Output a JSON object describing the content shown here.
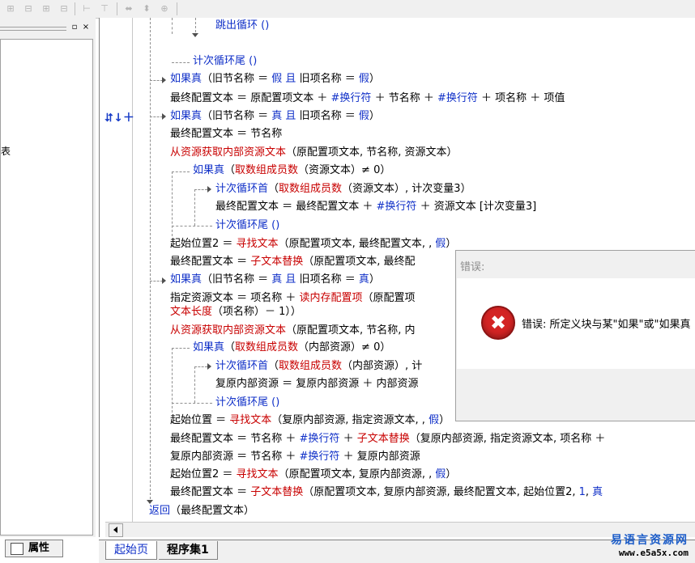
{
  "toolbar": {
    "icons": [
      "align-left-icon",
      "align-center-icon",
      "align-right-icon",
      "align-top-icon",
      "distribute-horizontal-icon",
      "align-bottom-icon",
      "same-width-icon",
      "same-height-icon",
      "same-size-icon"
    ]
  },
  "left_panel": {
    "pin_label": "▫",
    "close_label": "×",
    "partial_text": "表"
  },
  "bottom_tabs": {
    "property_label": "属性",
    "start_page": "起始页",
    "program_set": "程序集1"
  },
  "code_lines": [
    {
      "segments": [
        {
          "t": "跳出循环 ()",
          "c": "blue"
        }
      ]
    },
    {
      "segments": [
        {
          "t": "计次循环尾 ()",
          "c": "blue"
        }
      ]
    },
    {
      "segments": [
        {
          "t": "如果真",
          "c": "blue"
        },
        {
          "t": "（旧节名称 ＝ ",
          "c": "black"
        },
        {
          "t": "假",
          "c": "blue"
        },
        {
          "t": " 且 ",
          "c": "blue"
        },
        {
          "t": "旧项名称 ＝ ",
          "c": "black"
        },
        {
          "t": "假",
          "c": "blue"
        },
        {
          "t": "）",
          "c": "black"
        }
      ]
    },
    {
      "segments": [
        {
          "t": "最终配置文本 ＝ 原配置项文本 ＋ ",
          "c": "black"
        },
        {
          "t": "#换行符",
          "c": "blue"
        },
        {
          "t": " ＋ 节名称 ＋ ",
          "c": "black"
        },
        {
          "t": "#换行符",
          "c": "blue"
        },
        {
          "t": " ＋ 项名称 ＋ 项值",
          "c": "black"
        }
      ]
    },
    {
      "segments": [
        {
          "t": "如果真",
          "c": "blue"
        },
        {
          "t": "（旧节名称 ＝ ",
          "c": "black"
        },
        {
          "t": "真",
          "c": "blue"
        },
        {
          "t": " 且 ",
          "c": "blue"
        },
        {
          "t": "旧项名称 ＝ ",
          "c": "black"
        },
        {
          "t": "假",
          "c": "blue"
        },
        {
          "t": "）",
          "c": "black"
        }
      ]
    },
    {
      "segments": [
        {
          "t": "最终配置文本 ＝ 节名称",
          "c": "black"
        }
      ]
    },
    {
      "segments": [
        {
          "t": "从资源获取内部资源文本",
          "c": "red"
        },
        {
          "t": "（原配置项文本, 节名称, 资源文本）",
          "c": "black"
        }
      ]
    },
    {
      "segments": [
        {
          "t": "如果真",
          "c": "blue"
        },
        {
          "t": "（",
          "c": "black"
        },
        {
          "t": "取数组成员数",
          "c": "red"
        },
        {
          "t": "（资源文本）≠ 0）",
          "c": "black"
        }
      ]
    },
    {
      "segments": [
        {
          "t": "计次循环首",
          "c": "blue"
        },
        {
          "t": "（",
          "c": "black"
        },
        {
          "t": "取数组成员数",
          "c": "red"
        },
        {
          "t": "（资源文本）, 计次变量3）",
          "c": "black"
        }
      ]
    },
    {
      "segments": [
        {
          "t": "最终配置文本 ＝ 最终配置文本 ＋ ",
          "c": "black"
        },
        {
          "t": "#换行符",
          "c": "blue"
        },
        {
          "t": " ＋ 资源文本 [计次变量3]",
          "c": "black"
        }
      ]
    },
    {
      "segments": [
        {
          "t": "计次循环尾 ()",
          "c": "blue"
        }
      ]
    },
    {
      "segments": [
        {
          "t": "起始位置2 ＝ ",
          "c": "black"
        },
        {
          "t": "寻找文本",
          "c": "red"
        },
        {
          "t": "（原配置项文本, 最终配置文本, , ",
          "c": "black"
        },
        {
          "t": "假",
          "c": "blue"
        },
        {
          "t": "）",
          "c": "black"
        }
      ]
    },
    {
      "segments": [
        {
          "t": "最终配置文本 ＝ ",
          "c": "black"
        },
        {
          "t": "子文本替换",
          "c": "red"
        },
        {
          "t": "（原配置项文本, 最终配",
          "c": "black"
        }
      ]
    },
    {
      "segments": [
        {
          "t": "如果真",
          "c": "blue"
        },
        {
          "t": "（旧节名称 ＝ ",
          "c": "black"
        },
        {
          "t": "真",
          "c": "blue"
        },
        {
          "t": " 且 ",
          "c": "blue"
        },
        {
          "t": "旧项名称 ＝ ",
          "c": "black"
        },
        {
          "t": "真",
          "c": "blue"
        },
        {
          "t": "）",
          "c": "black"
        }
      ]
    },
    {
      "segments": [
        {
          "t": "指定资源文本 ＝ 项名称 ＋ ",
          "c": "black"
        },
        {
          "t": "读内存配置项",
          "c": "red"
        },
        {
          "t": "（原配置项",
          "c": "black"
        }
      ]
    },
    {
      "segments": [
        {
          "t": "文本长度",
          "c": "red"
        },
        {
          "t": "（项名称）－ 1））",
          "c": "black"
        }
      ]
    },
    {
      "segments": [
        {
          "t": "从资源获取内部资源文本",
          "c": "red"
        },
        {
          "t": "（原配置项文本, 节名称, 内",
          "c": "black"
        }
      ]
    },
    {
      "segments": [
        {
          "t": "如果真",
          "c": "blue"
        },
        {
          "t": "（",
          "c": "black"
        },
        {
          "t": "取数组成员数",
          "c": "red"
        },
        {
          "t": "（内部资源）≠ 0）",
          "c": "black"
        }
      ]
    },
    {
      "segments": [
        {
          "t": "计次循环首",
          "c": "blue"
        },
        {
          "t": "（",
          "c": "black"
        },
        {
          "t": "取数组成员数",
          "c": "red"
        },
        {
          "t": "（内部资源）, 计",
          "c": "black"
        }
      ]
    },
    {
      "segments": [
        {
          "t": "复原内部资源 ＝ 复原内部资源 ＋ 内部资源",
          "c": "black"
        }
      ]
    },
    {
      "segments": [
        {
          "t": "计次循环尾 ()",
          "c": "blue"
        }
      ]
    },
    {
      "segments": [
        {
          "t": "起始位置 ＝ ",
          "c": "black"
        },
        {
          "t": "寻找文本",
          "c": "red"
        },
        {
          "t": "（复原内部资源, 指定资源文本, , ",
          "c": "black"
        },
        {
          "t": "假",
          "c": "blue"
        },
        {
          "t": "）",
          "c": "black"
        }
      ]
    },
    {
      "segments": [
        {
          "t": "最终配置文本 ＝ 节名称 ＋ ",
          "c": "black"
        },
        {
          "t": "#换行符",
          "c": "blue"
        },
        {
          "t": " ＋ ",
          "c": "black"
        },
        {
          "t": "子文本替换",
          "c": "red"
        },
        {
          "t": "（复原内部资源, 指定资源文本, 项名称 ＋",
          "c": "black"
        }
      ]
    },
    {
      "segments": [
        {
          "t": "复原内部资源 ＝ 节名称 ＋ ",
          "c": "black"
        },
        {
          "t": "#换行符",
          "c": "blue"
        },
        {
          "t": " ＋ 复原内部资源",
          "c": "black"
        }
      ]
    },
    {
      "segments": [
        {
          "t": "起始位置2 ＝ ",
          "c": "black"
        },
        {
          "t": "寻找文本",
          "c": "red"
        },
        {
          "t": "（原配置项文本, 复原内部资源, , ",
          "c": "black"
        },
        {
          "t": "假",
          "c": "blue"
        },
        {
          "t": "）",
          "c": "black"
        }
      ]
    },
    {
      "segments": [
        {
          "t": "最终配置文本 ＝ ",
          "c": "black"
        },
        {
          "t": "子文本替换",
          "c": "red"
        },
        {
          "t": "（原配置项文本, 复原内部资源, 最终配置文本, 起始位置2, ",
          "c": "black"
        },
        {
          "t": "1",
          "c": "blue"
        },
        {
          "t": ", ",
          "c": "black"
        },
        {
          "t": "真",
          "c": "blue"
        }
      ]
    },
    {
      "segments": [
        {
          "t": "返回",
          "c": "blue"
        },
        {
          "t": "（最终配置文本）",
          "c": "black"
        }
      ]
    }
  ],
  "dialog": {
    "title": "错误:",
    "icon": "error-icon",
    "icon_glyph": "✖",
    "message": "错误: 所定义块与某\"如果\"或\"如果真"
  },
  "gutter_marker": "⮃↓＋",
  "watermark": {
    "cn": "易语言资源网",
    "url": "www.e5a5x.com"
  }
}
